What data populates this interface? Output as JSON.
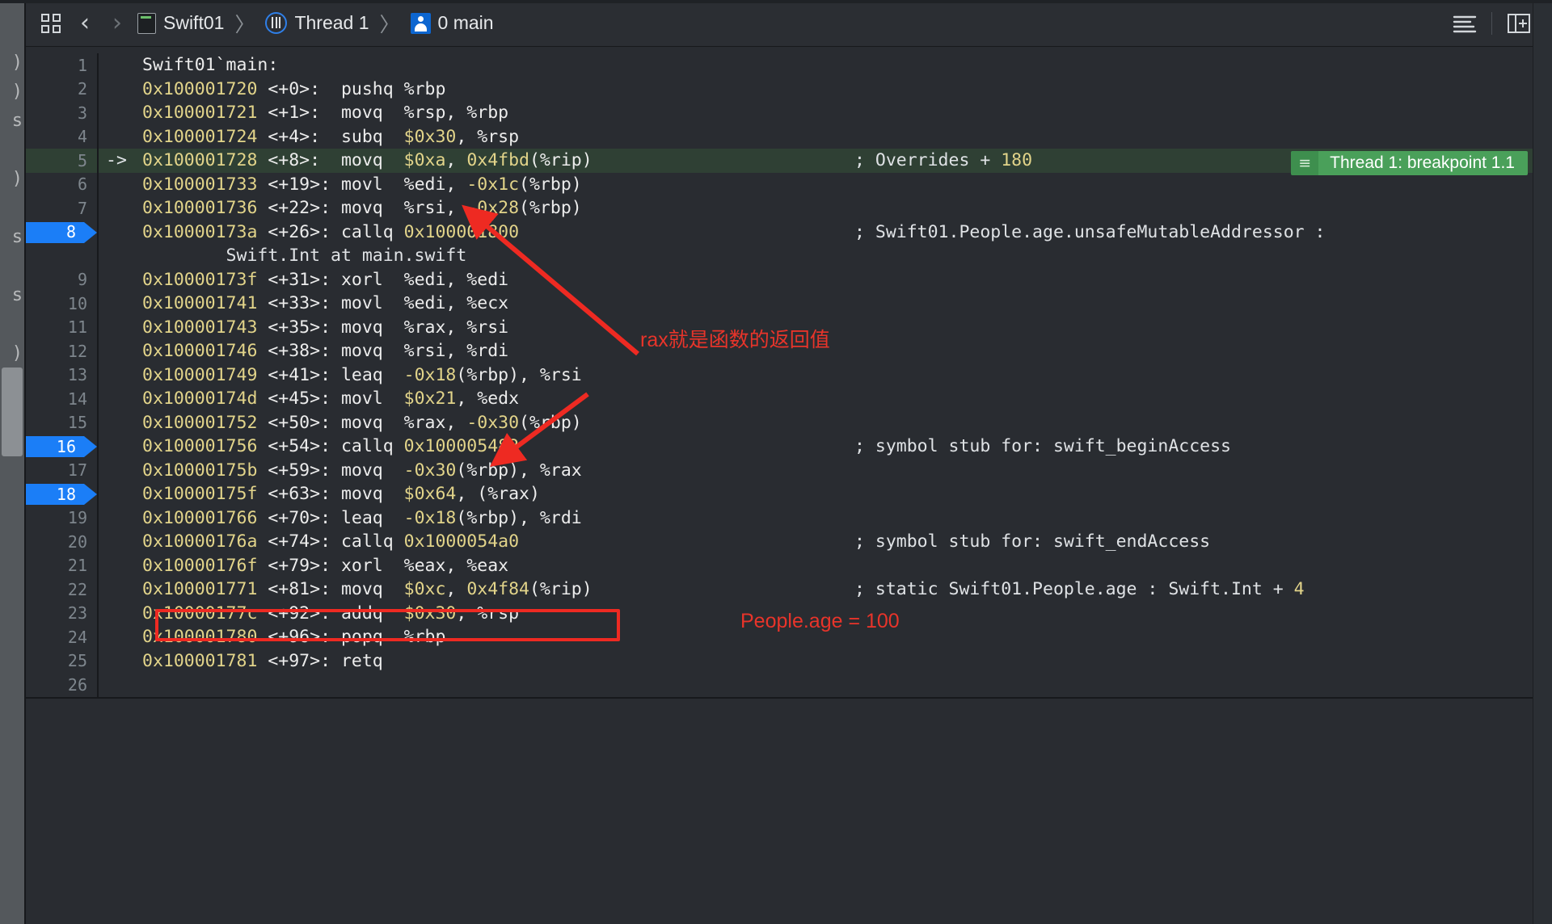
{
  "toolbar": {
    "grid_icon": "grid-layout-icon",
    "back_label": "‹",
    "forward_label": "›",
    "breadcrumb": [
      {
        "label": "Swift01",
        "icon": "project-icon"
      },
      {
        "label": "Thread 1",
        "icon": "thread-icon"
      },
      {
        "label": "0 main",
        "icon": "stack-frame-icon"
      }
    ],
    "separator": "〉",
    "right_icons": [
      {
        "name": "list-lines-icon",
        "label": ""
      },
      {
        "name": "add-editor-icon",
        "label": ""
      }
    ]
  },
  "left_panel": {
    "peek_text": ")\n)\ns\n \n)\n \ns\n \ns\n \n)"
  },
  "editor": {
    "header": "Swift01`main:",
    "current_arrow": "->",
    "breakpoint_badge": {
      "handle_glyph": "≡",
      "text": "Thread 1: breakpoint 1.1"
    },
    "lines": [
      {
        "n": "1",
        "arrow": "",
        "bp": false,
        "addr": "",
        "off": "",
        "mn": "",
        "ops": "",
        "cmt": "",
        "header": "Swift01`main:"
      },
      {
        "n": "2",
        "arrow": "",
        "bp": false,
        "addr": "0x100001720",
        "off": "<+0>:",
        "mn": "pushq",
        "ops": "%rbp",
        "cmt": ""
      },
      {
        "n": "3",
        "arrow": "",
        "bp": false,
        "addr": "0x100001721",
        "off": "<+1>:",
        "mn": "movq",
        "ops": "%rsp, %rbp",
        "cmt": ""
      },
      {
        "n": "4",
        "arrow": "",
        "bp": false,
        "addr": "0x100001724",
        "off": "<+4>:",
        "mn": "subq",
        "ops": "$0x30, %rsp",
        "cmt": ""
      },
      {
        "n": "5",
        "arrow": "->",
        "bp": false,
        "current": true,
        "addr": "0x100001728",
        "off": "<+8>:",
        "mn": "movq",
        "ops": "$0xa, 0x4fbd(%rip)",
        "cmt": "; Overrides + 180"
      },
      {
        "n": "6",
        "arrow": "",
        "bp": false,
        "addr": "0x100001733",
        "off": "<+19>:",
        "mn": "movl",
        "ops": "%edi, -0x1c(%rbp)",
        "cmt": ""
      },
      {
        "n": "7",
        "arrow": "",
        "bp": false,
        "addr": "0x100001736",
        "off": "<+22>:",
        "mn": "movq",
        "ops": "%rsi, -0x28(%rbp)",
        "cmt": ""
      },
      {
        "n": "8",
        "arrow": "",
        "bp": true,
        "addr": "0x10000173a",
        "off": "<+26>:",
        "mn": "callq",
        "ops": "0x100001800",
        "cmt": "; Swift01.People.age.unsafeMutableAddressor :"
      },
      {
        "n": "",
        "arrow": "",
        "bp": false,
        "continuation": "Swift.Int at main.swift"
      },
      {
        "n": "9",
        "arrow": "",
        "bp": false,
        "addr": "0x10000173f",
        "off": "<+31>:",
        "mn": "xorl",
        "ops": "%edi, %edi",
        "cmt": ""
      },
      {
        "n": "10",
        "arrow": "",
        "bp": false,
        "addr": "0x100001741",
        "off": "<+33>:",
        "mn": "movl",
        "ops": "%edi, %ecx",
        "cmt": ""
      },
      {
        "n": "11",
        "arrow": "",
        "bp": false,
        "addr": "0x100001743",
        "off": "<+35>:",
        "mn": "movq",
        "ops": "%rax, %rsi",
        "cmt": ""
      },
      {
        "n": "12",
        "arrow": "",
        "bp": false,
        "addr": "0x100001746",
        "off": "<+38>:",
        "mn": "movq",
        "ops": "%rsi, %rdi",
        "cmt": ""
      },
      {
        "n": "13",
        "arrow": "",
        "bp": false,
        "addr": "0x100001749",
        "off": "<+41>:",
        "mn": "leaq",
        "ops": "-0x18(%rbp), %rsi",
        "cmt": ""
      },
      {
        "n": "14",
        "arrow": "",
        "bp": false,
        "addr": "0x10000174d",
        "off": "<+45>:",
        "mn": "movl",
        "ops": "$0x21, %edx",
        "cmt": ""
      },
      {
        "n": "15",
        "arrow": "",
        "bp": false,
        "addr": "0x100001752",
        "off": "<+50>:",
        "mn": "movq",
        "ops": "%rax, -0x30(%rbp)",
        "cmt": ""
      },
      {
        "n": "16",
        "arrow": "",
        "bp": true,
        "addr": "0x100001756",
        "off": "<+54>:",
        "mn": "callq",
        "ops": "0x100005482",
        "cmt": "; symbol stub for: swift_beginAccess"
      },
      {
        "n": "17",
        "arrow": "",
        "bp": false,
        "addr": "0x10000175b",
        "off": "<+59>:",
        "mn": "movq",
        "ops": "-0x30(%rbp), %rax",
        "cmt": ""
      },
      {
        "n": "18",
        "arrow": "",
        "bp": true,
        "addr": "0x10000175f",
        "off": "<+63>:",
        "mn": "movq",
        "ops": "$0x64, (%rax)",
        "cmt": ""
      },
      {
        "n": "19",
        "arrow": "",
        "bp": false,
        "addr": "0x100001766",
        "off": "<+70>:",
        "mn": "leaq",
        "ops": "-0x18(%rbp), %rdi",
        "cmt": ""
      },
      {
        "n": "20",
        "arrow": "",
        "bp": false,
        "addr": "0x10000176a",
        "off": "<+74>:",
        "mn": "callq",
        "ops": "0x1000054a0",
        "cmt": "; symbol stub for: swift_endAccess"
      },
      {
        "n": "21",
        "arrow": "",
        "bp": false,
        "addr": "0x10000176f",
        "off": "<+79>:",
        "mn": "xorl",
        "ops": "%eax, %eax",
        "cmt": ""
      },
      {
        "n": "22",
        "arrow": "",
        "bp": false,
        "addr": "0x100001771",
        "off": "<+81>:",
        "mn": "movq",
        "ops": "$0xc, 0x4f84(%rip)",
        "cmt": "; static Swift01.People.age : Swift.Int + 4"
      },
      {
        "n": "23",
        "arrow": "",
        "bp": false,
        "addr": "0x10000177c",
        "off": "<+92>:",
        "mn": "addq",
        "ops": "$0x30, %rsp",
        "cmt": ""
      },
      {
        "n": "24",
        "arrow": "",
        "bp": false,
        "addr": "0x100001780",
        "off": "<+96>:",
        "mn": "popq",
        "ops": "%rbp",
        "cmt": ""
      },
      {
        "n": "25",
        "arrow": "",
        "bp": false,
        "addr": "0x100001781",
        "off": "<+97>:",
        "mn": "retq",
        "ops": "",
        "cmt": ""
      },
      {
        "n": "26",
        "arrow": "",
        "bp": false,
        "addr": "",
        "off": "",
        "mn": "",
        "ops": "",
        "cmt": ""
      }
    ]
  },
  "annotations": {
    "rax_note": "rax就是函数的返回值",
    "age_note": "People.age = 100",
    "box_color": "#ee2a22",
    "text_color": "#e8342a"
  },
  "colors": {
    "background": "#292c31",
    "toolbar": "#2b2e33",
    "address": "#e2d48a",
    "text": "#e4e7ea",
    "breakpoint": "#1b7ef7",
    "current_line": "#2f4034",
    "badge": "#4aa05a",
    "annotation": "#e8342a"
  }
}
